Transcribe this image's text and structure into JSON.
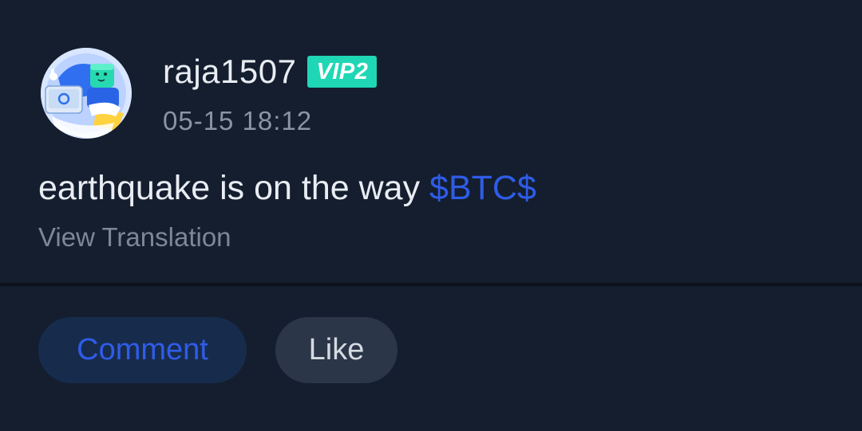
{
  "post": {
    "author": {
      "username": "raja1507",
      "badge": "VIP2",
      "avatar_icon": "cartoon-avatar-icon"
    },
    "timestamp": "05-15 18:12",
    "text": "earthquake is on the way ",
    "tag": "$BTC$",
    "view_translation_label": "View Translation"
  },
  "actions": {
    "comment_label": "Comment",
    "like_label": "Like"
  },
  "colors": {
    "background": "#141e2e",
    "accent": "#2f5ce8",
    "badge": "#1fd7b5"
  }
}
